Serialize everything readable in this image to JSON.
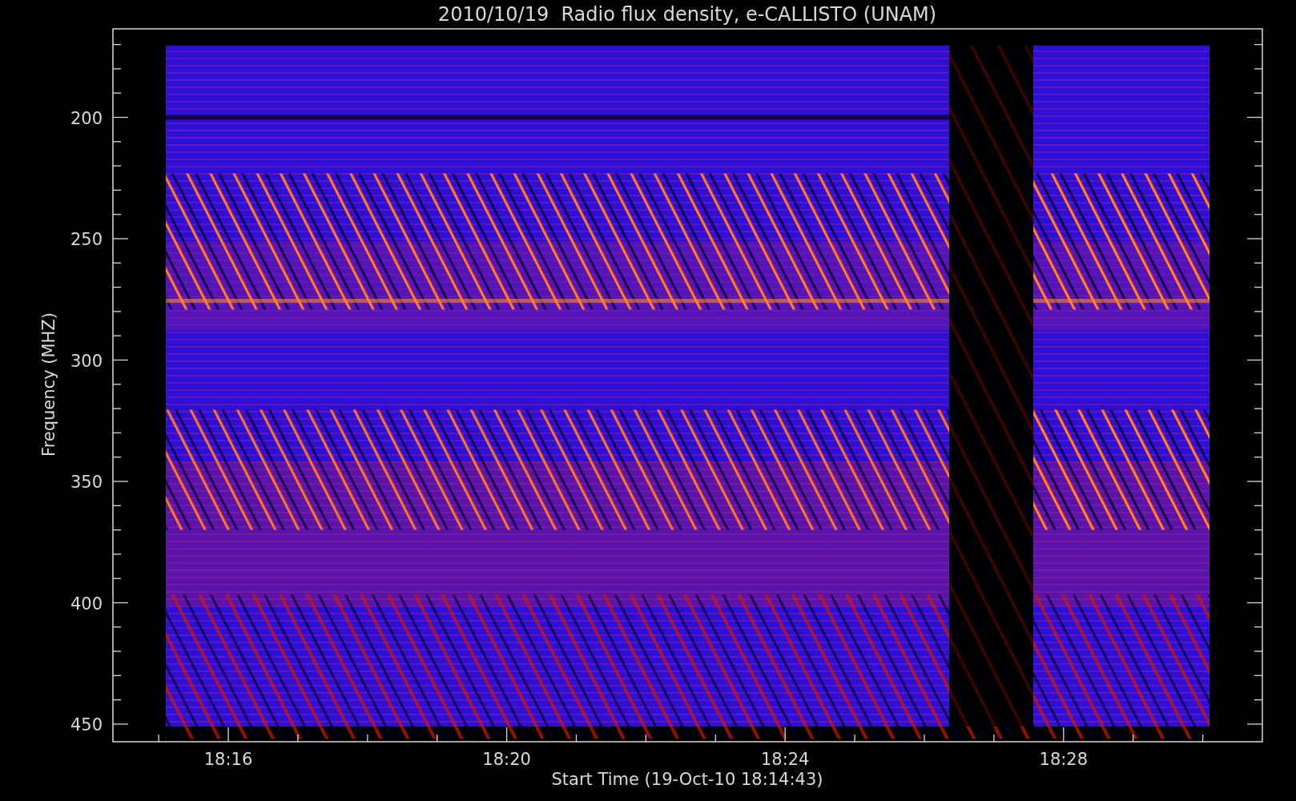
{
  "title": "2010/10/19  Radio flux density, e-CALLISTO (UNAM)",
  "y_axis": {
    "label": "Frequency (MHZ)",
    "ticks": [
      "200",
      "250",
      "300",
      "350",
      "400",
      "450"
    ]
  },
  "x_axis": {
    "label": "Start Time (19-Oct-10 18:14:43)",
    "ticks": [
      "18:16",
      "18:20",
      "18:24",
      "18:28"
    ]
  }
}
